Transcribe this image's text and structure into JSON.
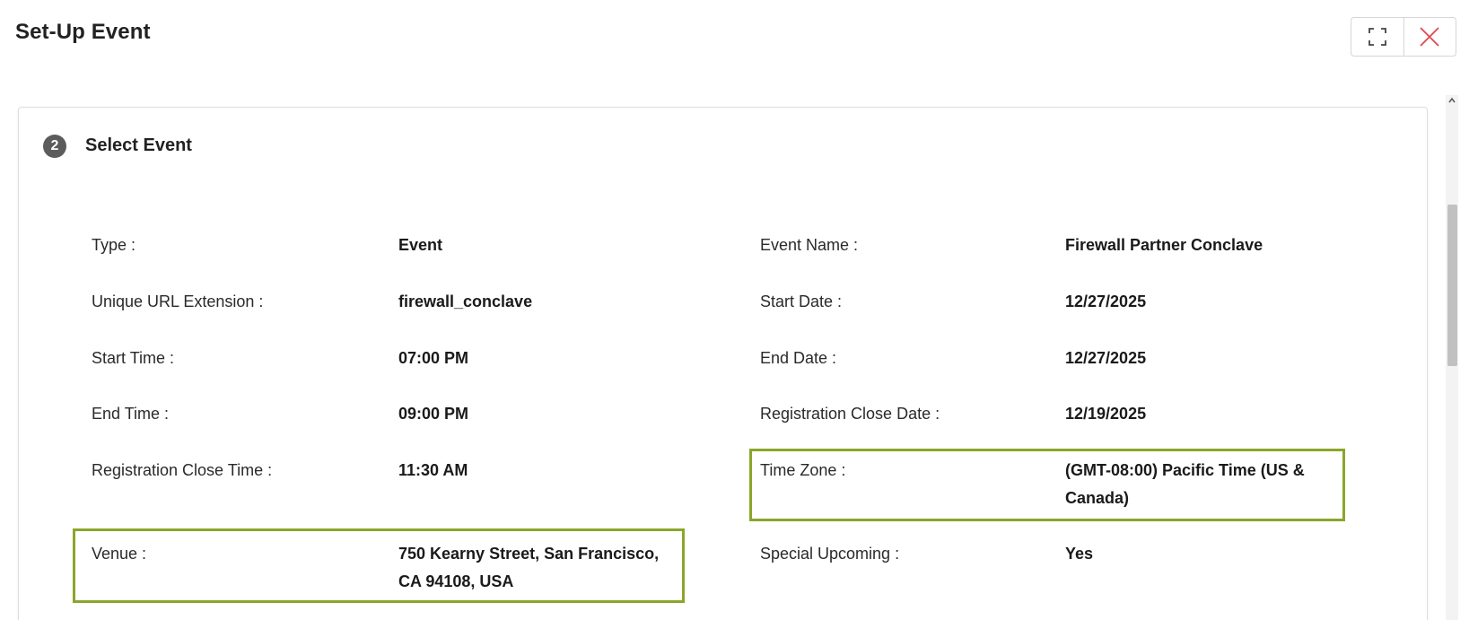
{
  "modal": {
    "title": "Set-Up Event",
    "controls": {
      "expand_icon": "expand-icon",
      "close_icon": "close-icon",
      "close_color": "#e0484d"
    }
  },
  "step": {
    "number": "2",
    "title": "Select Event"
  },
  "details": {
    "left": [
      {
        "label": "Type :",
        "value": "Event"
      },
      {
        "label": "Unique URL Extension :",
        "value": "firewall_conclave"
      },
      {
        "label": "Start Time :",
        "value": "07:00 PM"
      },
      {
        "label": "End Time :",
        "value": "09:00 PM"
      },
      {
        "label": "Registration Close Time :",
        "value": "11:30 AM"
      },
      {
        "label": "Venue :",
        "value_line1": "750 Kearny Street, San Francisco,",
        "value_line2": "CA 94108, USA"
      }
    ],
    "right": [
      {
        "label": "Event Name :",
        "value": "Firewall Partner Conclave"
      },
      {
        "label": "Start Date :",
        "value": "12/27/2025"
      },
      {
        "label": "End Date :",
        "value": "12/27/2025"
      },
      {
        "label": "Registration Close Date :",
        "value": "12/19/2025"
      },
      {
        "label": "Time Zone :",
        "value_line1": "(GMT-08:00) Pacific Time (US &",
        "value_line2": "Canada)"
      },
      {
        "label": "Special Upcoming :",
        "value": "Yes"
      }
    ]
  },
  "colors": {
    "highlight": "#8aa62a",
    "badge": "#5c5c5c"
  }
}
